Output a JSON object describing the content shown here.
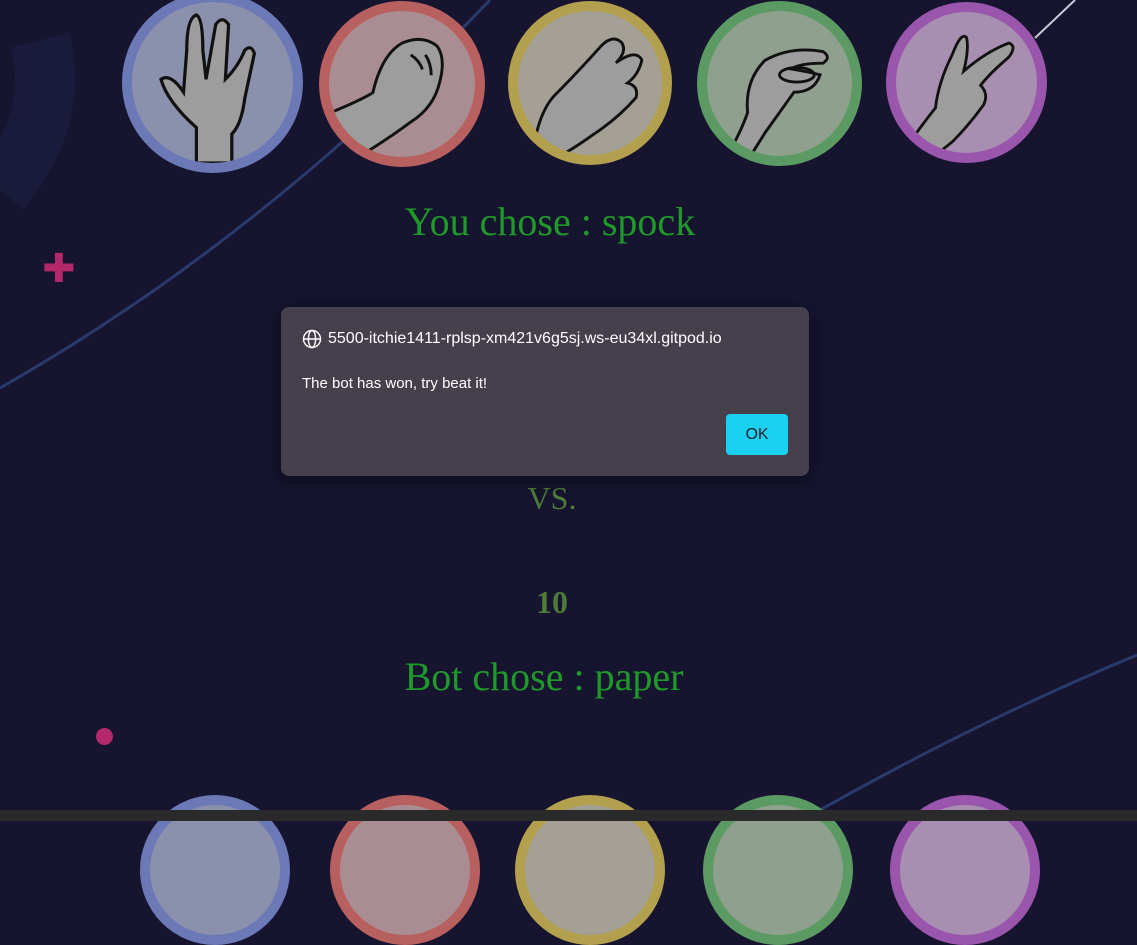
{
  "game": {
    "you_chose_label": "You chose : spock",
    "vs_label": "VS.",
    "score": "10",
    "bot_chose_label": "Bot chose : paper"
  },
  "choices": [
    {
      "name": "spock",
      "ring_color": "#6b79b6",
      "fill_color": "#8b90ad"
    },
    {
      "name": "rock",
      "ring_color": "#b8605f",
      "fill_color": "#a98d92"
    },
    {
      "name": "paper",
      "ring_color": "#b3a04f",
      "fill_color": "#a5a095"
    },
    {
      "name": "lizard",
      "ring_color": "#5b9a63",
      "fill_color": "#8fa08f"
    },
    {
      "name": "scissors",
      "ring_color": "#9a55ad",
      "fill_color": "#a88eb0"
    }
  ],
  "dialog": {
    "origin": "5500-itchie1411-rplsp-xm421v6g5sj.ws-eu34xl.gitpod.io",
    "message": "The bot has won, try beat it!",
    "ok_label": "OK"
  },
  "colors": {
    "background": "#16142f",
    "label_green": "#1f9a2a",
    "dim_green": "#4e7a3a",
    "accent_pink": "#b3286b",
    "dialog_bg": "#45404b",
    "ok_button": "#1bd1f2"
  }
}
